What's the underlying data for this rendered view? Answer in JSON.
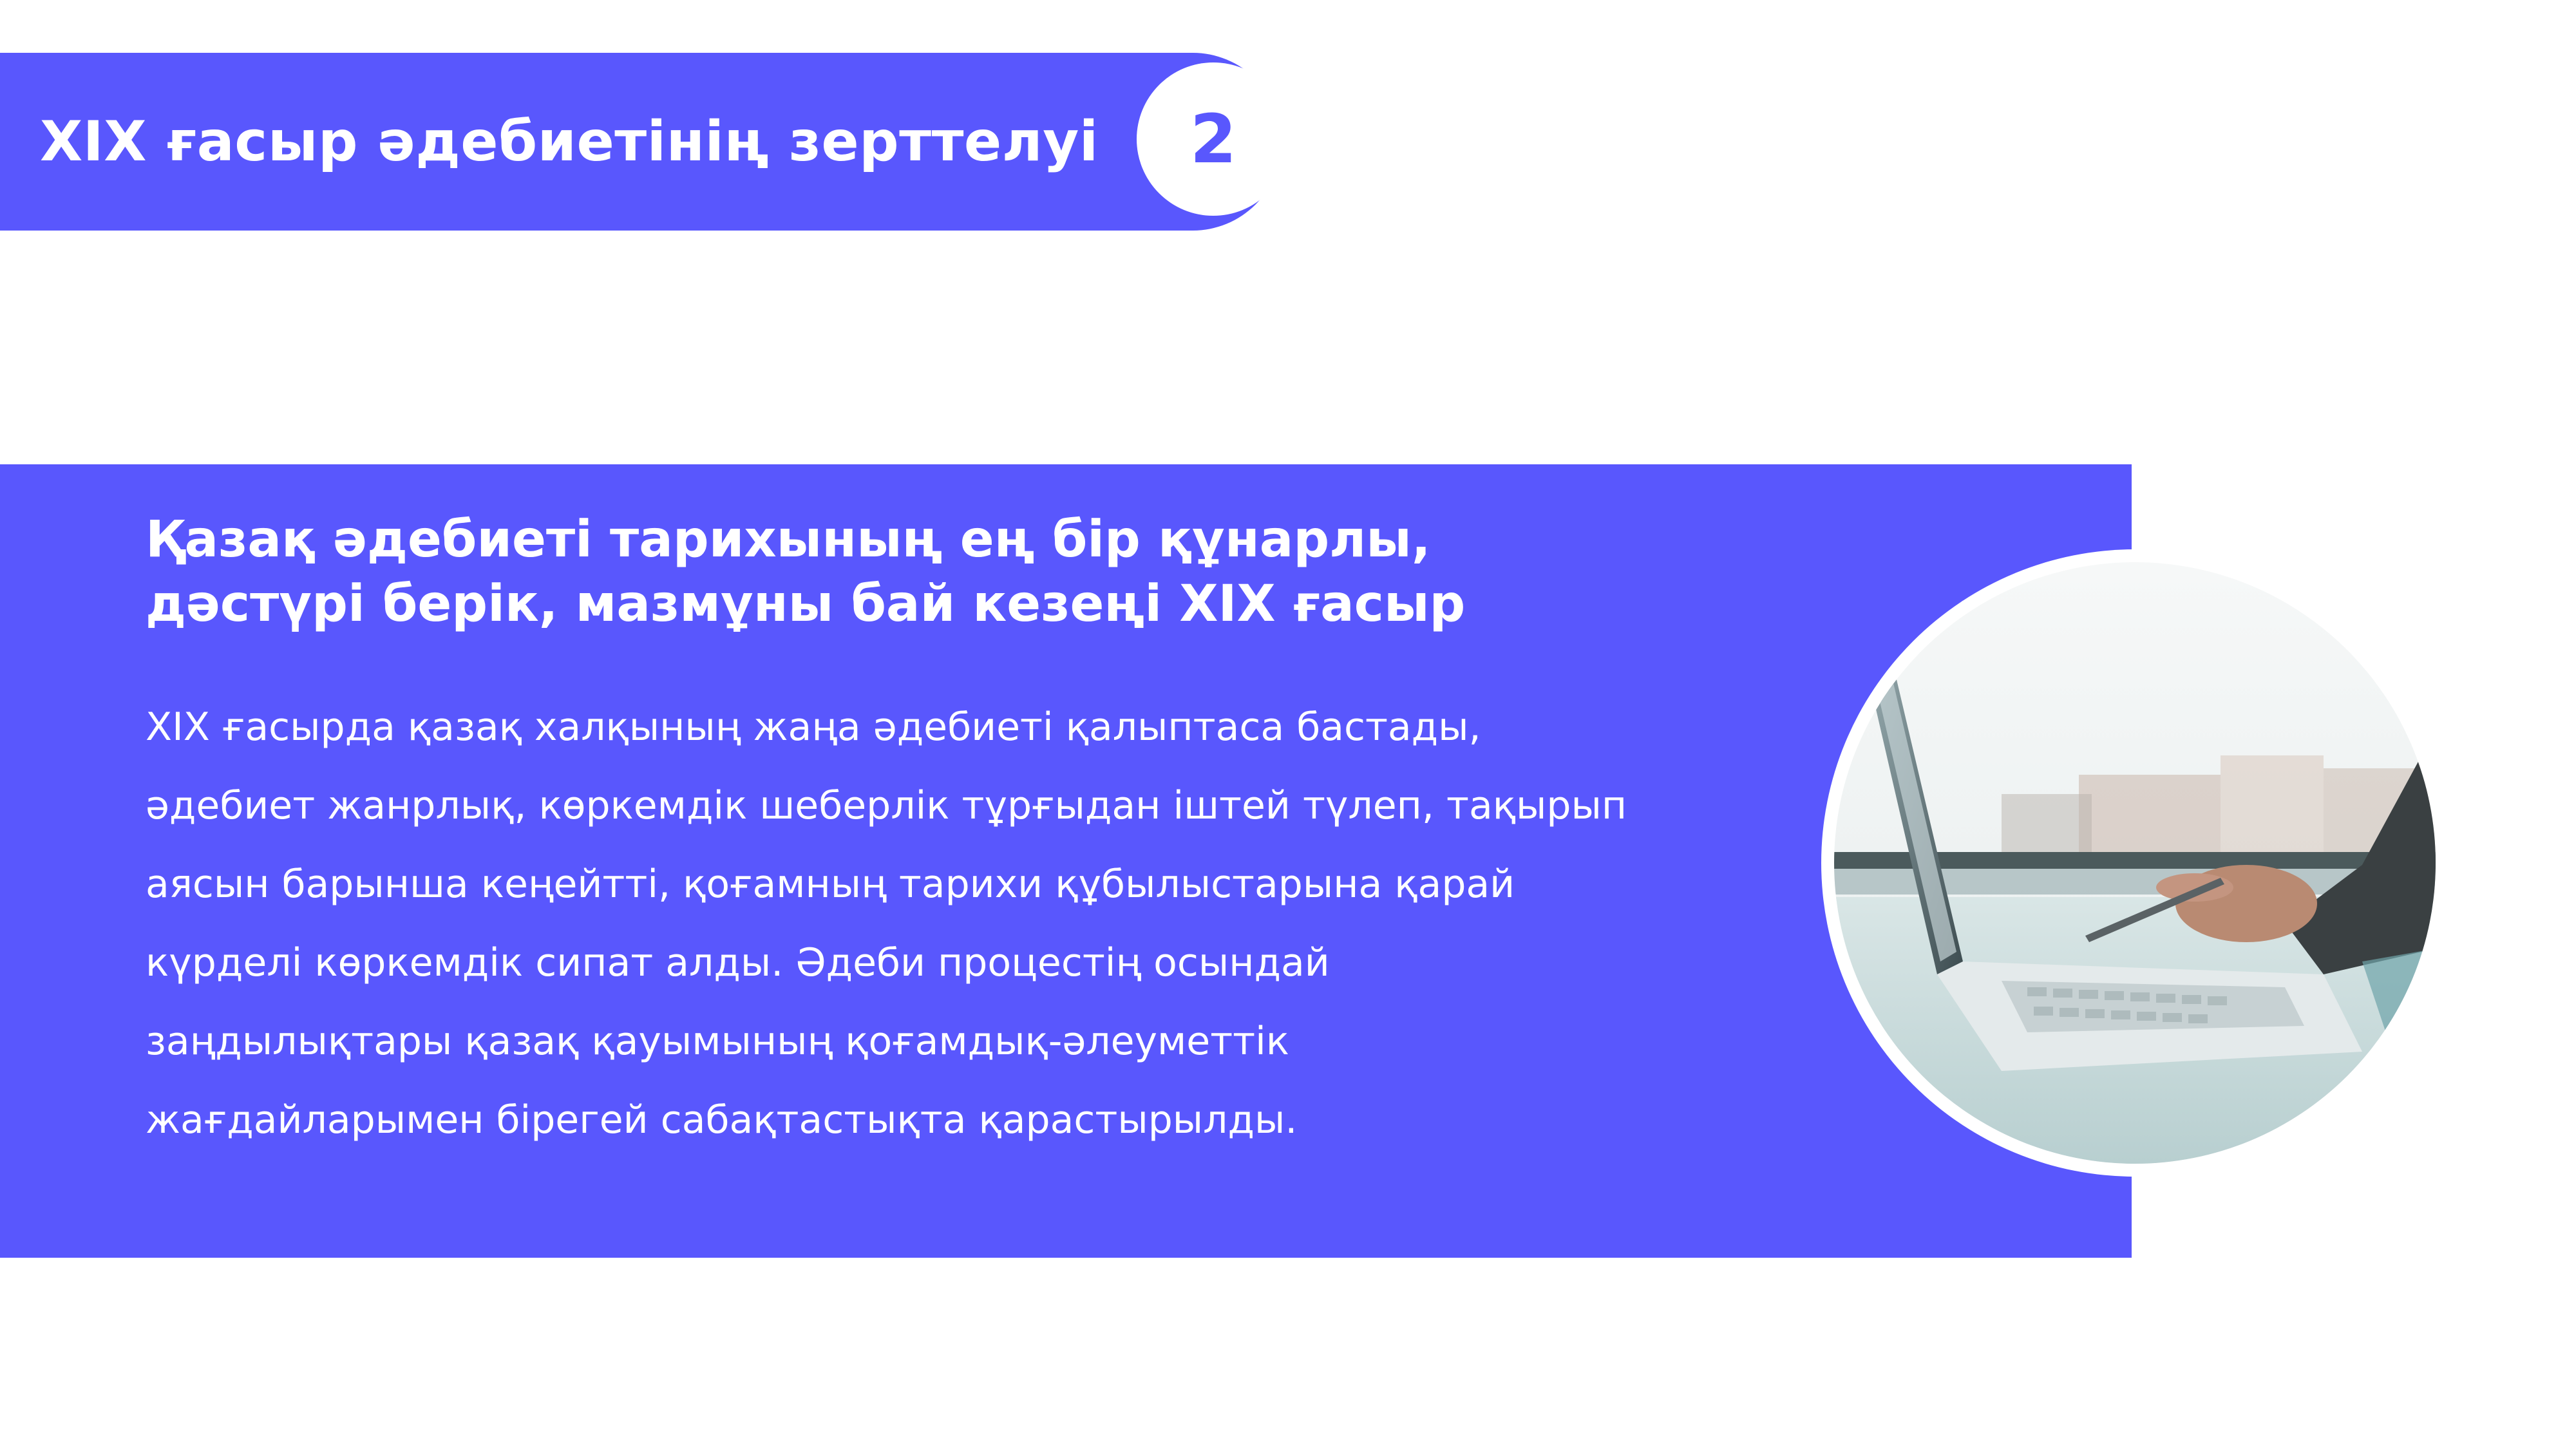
{
  "header": {
    "title": "XIX ғасыр әдебиетінің зерттелуі",
    "number": "2"
  },
  "content": {
    "headline_lines": [
      "Қазақ әдебиеті тарихының ең бір құнарлы,",
      "дәстүрі берік, мазмұны бай кезеңі XIX ғасыр"
    ],
    "body_lines": [
      "XIX ғасырда қазақ халқының жаңа әдебиеті қалыптаса бастады,",
      "әдебиет жанрлық, көркемдік шеберлік тұрғыдан іштей түлеп, тақырып",
      "аясын барынша кеңейтті, қоғамның тарихи құбылыстарына қарай",
      "күрделі көркемдік сипат алды. Әдеби процестің осындай",
      "заңдылықтары қазақ қауымының қоғамдық-әлеуметтік",
      "жағдайларымен бірегей сабақтастықта қарастырылды."
    ]
  },
  "colors": {
    "accent": "#5957fd",
    "text_on_accent": "#ffffff",
    "background": "#ffffff"
  },
  "image": {
    "subject": "hand with pen using laptop near window"
  }
}
